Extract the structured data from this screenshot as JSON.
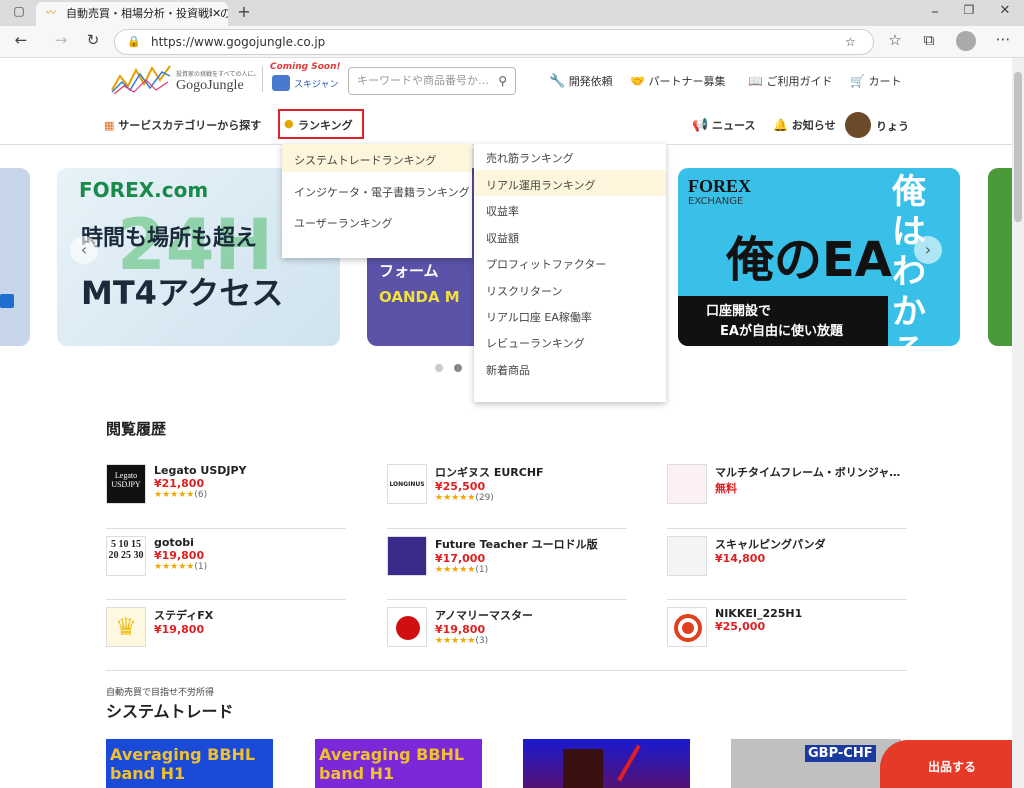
{
  "browser": {
    "tab_title": "自動売買・相場分析・投資戦略の",
    "url": "https://www.gogojungle.co.jp"
  },
  "header": {
    "logo_tagline": "投資家の挑戦をすべての人に。",
    "logo_text": "GogoJungle",
    "coming_soon": "Coming Soon!",
    "sukijan": "スキジャン",
    "search_placeholder": "キーワードや商品番号か…",
    "nav": [
      "開発依頼",
      "パートナー募集",
      "ご利用ガイド",
      "カート"
    ]
  },
  "subnav": {
    "category": "サービスカテゴリーから探す",
    "ranking": "ランキング",
    "news": "ニュース",
    "notice": "お知らせ",
    "user": "りょう"
  },
  "ranking_menu": {
    "left": [
      "システムトレードランキング",
      "インジケータ・電子書籍ランキング",
      "ユーザーランキング"
    ],
    "right": [
      "売れ筋ランキング",
      "リアル運用ランキング",
      "収益率",
      "収益額",
      "プロフィットファクター",
      "リスクリターン",
      "リアル口座 EA稼働率",
      "レビューランキング",
      "新着商品"
    ]
  },
  "banners": {
    "forex_com": "FOREX.com",
    "forex_line1": "時間も場所も超え",
    "forex_line2": "MT4アクセス",
    "oanda_line1": "フォーム",
    "oanda_line2": "OANDA M",
    "fx_logo": "FOREX",
    "fx_exchange": "EXCHANGE",
    "fx_big": "俺のEA",
    "fx_right": "俺はわかるだけ",
    "fx_caption1": "口座開設で",
    "fx_caption2": "EAが自由に使い放題"
  },
  "history": {
    "title": "閲覧履歴",
    "items": [
      {
        "name": "Legato USDJPY",
        "price": "¥21,800",
        "stars": "★★★★★",
        "count": "(6)",
        "thumb": "Legato USDJPY"
      },
      {
        "name": "ロンギヌス EURCHF",
        "price": "¥25,500",
        "stars": "★★★★★",
        "count": "(29)",
        "thumb": "LONGINUS"
      },
      {
        "name": "マルチタイムフレーム・ボリンジャー…",
        "price": "無料",
        "stars": "",
        "count": "",
        "thumb": ""
      },
      {
        "name": "gotobi",
        "price": "¥19,800",
        "stars": "★★★★★",
        "count": "(1)",
        "thumb": "5 10 15 20 25 30"
      },
      {
        "name": "Future Teacher ユーロドル版",
        "price": "¥17,000",
        "stars": "★★★★★",
        "count": "(1)",
        "thumb": ""
      },
      {
        "name": "スキャルピングパンダ",
        "price": "¥14,800",
        "stars": "",
        "count": "",
        "thumb": ""
      },
      {
        "name": "ステディFX",
        "price": "¥19,800",
        "stars": "",
        "count": "",
        "thumb": ""
      },
      {
        "name": "アノマリーマスター",
        "price": "¥19,800",
        "stars": "★★★★★",
        "count": "(3)",
        "thumb": ""
      },
      {
        "name": "NIKKEI_225H1",
        "price": "¥25,000",
        "stars": "",
        "count": "",
        "thumb": ""
      }
    ]
  },
  "systrade": {
    "subtitle": "自動売買で目指せ不労所得",
    "title": "システムトレード",
    "card1": "Averaging BBHL band H1",
    "card2": "Averaging BBHL band H1",
    "card4": "GBP-CHF"
  },
  "sell_button": "出品する",
  "colors": {
    "accent": "#e02020",
    "highlight": "#fdf6dc",
    "ranking_border": "#e0202a"
  }
}
